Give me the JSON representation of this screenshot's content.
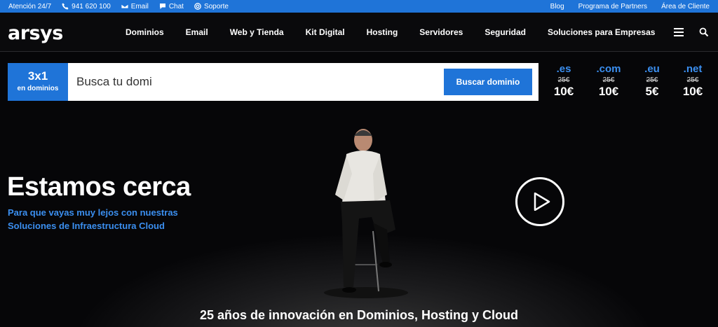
{
  "topbar": {
    "support_label": "Atención 24/7",
    "phone": "941 620 100",
    "email": "Email",
    "chat": "Chat",
    "soporte": "Soporte",
    "blog": "Blog",
    "partners": "Programa de Partners",
    "client_area": "Área de Cliente"
  },
  "brand": {
    "logo": "arsys",
    "accent": "#1f74d8"
  },
  "nav": {
    "items": [
      "Dominios",
      "Email",
      "Web y Tienda",
      "Kit Digital",
      "Hosting",
      "Servidores",
      "Seguridad",
      "Soluciones para Empresas"
    ]
  },
  "search": {
    "promo_big": "3x1",
    "promo_small": "en dominios",
    "value": "Busca tu domi",
    "button": "Buscar dominio"
  },
  "tlds": [
    {
      "ext": ".es",
      "old": "25€",
      "new": "10€"
    },
    {
      "ext": ".com",
      "old": "25€",
      "new": "10€"
    },
    {
      "ext": ".eu",
      "old": "25€",
      "new": "5€"
    },
    {
      "ext": ".net",
      "old": "25€",
      "new": "10€"
    }
  ],
  "hero": {
    "headline": "Estamos cerca",
    "sub": "Para que vayas muy lejos con nuestras Soluciones de Infraestructura Cloud",
    "tagline": "25 años de innovación en Dominios, Hosting y Cloud"
  }
}
